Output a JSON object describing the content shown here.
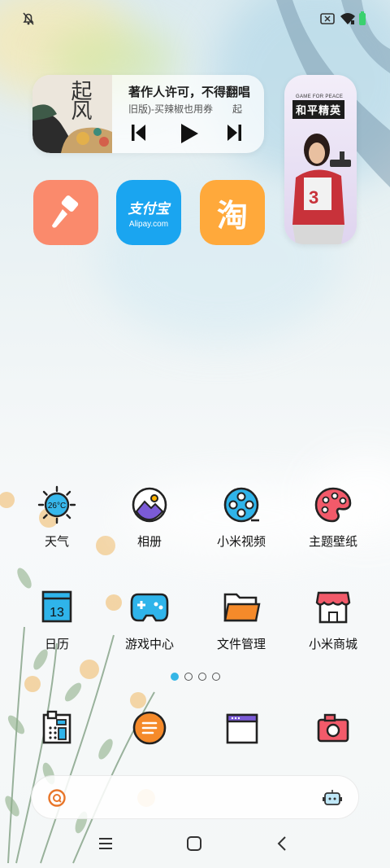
{
  "status_bar": {
    "icons": [
      "bell-off-icon",
      "sim-x-icon",
      "wifi-icon",
      "battery-icon"
    ]
  },
  "music_widget": {
    "album_text": "起风",
    "title": "著作人许可，不得翻唱",
    "subtitle": "旧版)-买辣椒也用券　　起",
    "controls": [
      "previous-icon",
      "play-icon",
      "next-icon"
    ]
  },
  "game_widget": {
    "brand_small": "GAME FOR PEACE",
    "brand": "和平精英",
    "jersey_number": "3"
  },
  "shortcut_apps": [
    {
      "name": "paint-brush-app",
      "color": "#fa8a6c"
    },
    {
      "name": "alipay-app",
      "text_top": "支付宝",
      "text_bottom": "Alipay.com",
      "color": "#1aa5f0"
    },
    {
      "name": "taobao-app",
      "text": "淘",
      "color": "#ffa93b"
    }
  ],
  "grid_apps": [
    {
      "label": "天气",
      "icon": "weather-icon",
      "temp": "26°C"
    },
    {
      "label": "相册",
      "icon": "gallery-icon"
    },
    {
      "label": "小米视频",
      "icon": "video-icon"
    },
    {
      "label": "主题壁纸",
      "icon": "themes-icon"
    },
    {
      "label": "日历",
      "icon": "calendar-icon",
      "date": "13"
    },
    {
      "label": "游戏中心",
      "icon": "game-center-icon"
    },
    {
      "label": "文件管理",
      "icon": "file-manager-icon"
    },
    {
      "label": "小米商城",
      "icon": "mi-store-icon"
    }
  ],
  "page_indicator": {
    "count": 4,
    "active": 0
  },
  "dock": [
    "phone-icon",
    "messages-icon",
    "browser-icon",
    "camera-icon"
  ],
  "search_bar": {
    "left_icon": "search-icon",
    "right_icon": "assistant-robot-icon"
  },
  "nav_bar": [
    "menu-icon",
    "home-icon",
    "back-icon"
  ],
  "colors": {
    "accent": "#35b6e6",
    "icon_yellow": "#ffb300",
    "icon_red": "#f25a6a",
    "icon_blue": "#2fb4ea"
  }
}
